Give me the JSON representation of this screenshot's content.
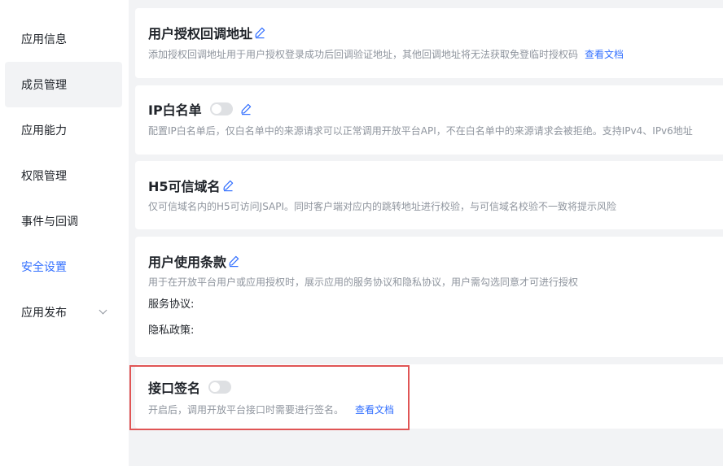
{
  "sidebar": {
    "items": [
      {
        "label": "应用信息"
      },
      {
        "label": "成员管理"
      },
      {
        "label": "应用能力"
      },
      {
        "label": "权限管理"
      },
      {
        "label": "事件与回调"
      },
      {
        "label": "安全设置"
      },
      {
        "label": "应用发布"
      }
    ],
    "active_item": "安全设置",
    "hover_item": "成员管理"
  },
  "sections": {
    "redirect": {
      "title": "用户授权回调地址",
      "desc": "添加授权回调地址用于用户授权登录成功后回调验证地址，其他回调地址将无法获取免登临时授权码",
      "link": "查看文档"
    },
    "ip_whitelist": {
      "title": "IP白名单",
      "toggle_on": false,
      "desc": "配置IP白名单后，仅白名单中的来源请求可以正常调用开放平台API，不在白名单中的来源请求会被拒绝。支持IPv4、IPv6地址"
    },
    "h5_domain": {
      "title": "H5可信域名",
      "desc": "仅可信域名内的H5可访问JSAPI。同时客户端对应内的跳转地址进行校验，与可信域名校验不一致将提示风险"
    },
    "terms": {
      "title": "用户使用条款",
      "desc": "用于在开放平台用户或应用授权时，展示应用的服务协议和隐私协议，用户需勾选同意才可进行授权",
      "service_label": "服务协议:",
      "privacy_label": "隐私政策:"
    },
    "signature": {
      "title": "接口签名",
      "toggle_on": false,
      "desc": "开启后，调用开放平台接口时需要进行签名。",
      "link": "查看文档"
    }
  },
  "colors": {
    "accent": "#3370ff",
    "highlight_border": "#e05555",
    "toggle_off": "#dee0e3"
  }
}
